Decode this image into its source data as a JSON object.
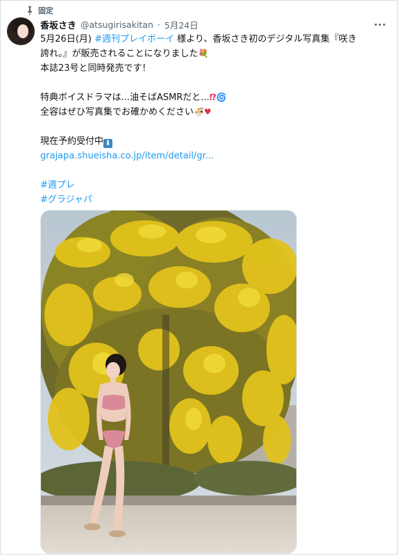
{
  "pinned": {
    "label": "固定"
  },
  "author": {
    "display_name": "香坂さき",
    "handle": "@atsugirisakitan",
    "separator": "·",
    "date": "5月24日"
  },
  "tweet": {
    "line1_prefix": "5月26日(月) ",
    "line1_link": "#週刊プレイボーイ",
    "line1_suffix": " 様より、香坂さき初のデジタル写真集『咲き",
    "line2_text": "誇れ。』が販売されることになりました",
    "line3_text": "本誌23号と同時発売です！",
    "line5_text": "特典ボイスドラマは...油そばASMRだと...",
    "line6_text": "全容はぜひ写真集でお確かめください",
    "line8_text": "現在予約受付中",
    "link_url": "grajapa.shueisha.co.jp/item/detail/gr...",
    "hashtags": [
      "#週プレ",
      "#グラジャパ"
    ]
  },
  "icons": {
    "pin": "pin-icon",
    "more": "more-horizontal-icon",
    "bouquet": "bouquet-emoji",
    "interrobang": "interrobang-emoji",
    "cyclone": "cyclone-emoji",
    "bowl": "noodle-bowl-emoji",
    "heart": "red-heart-emoji",
    "down_arrow": "down-arrow-emoji"
  },
  "media": {
    "description_icon": "photo-woman-under-mimosa-tree"
  },
  "colors": {
    "link": "#1d9bf0",
    "text": "#0f1419",
    "muted": "#536471",
    "interrobang": "#e0245e",
    "heart": "#dd2e44"
  }
}
